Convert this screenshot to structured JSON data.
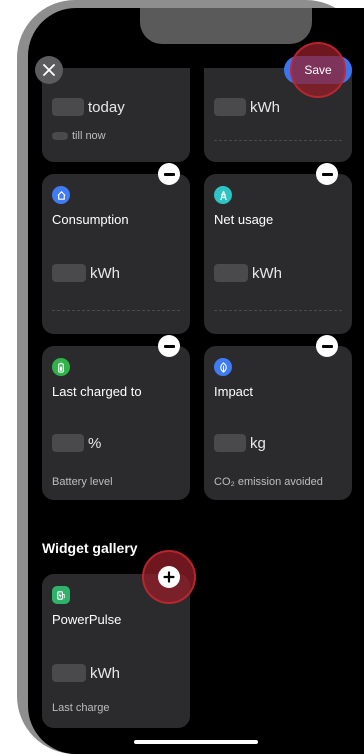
{
  "header": {
    "save_label": "Save"
  },
  "top_cards": [
    {
      "unit": "today",
      "caption": "till now"
    },
    {
      "unit": "kWh"
    }
  ],
  "widgets": [
    {
      "title": "Consumption",
      "unit": "kWh",
      "icon": "home-icon",
      "color": "#3f7bf5"
    },
    {
      "title": "Net usage",
      "unit": "kWh",
      "icon": "tower-icon",
      "color": "#2ec4c4"
    },
    {
      "title": "Last charged to",
      "unit": "%",
      "caption": "Battery level",
      "icon": "battery-icon",
      "color": "#2fb34a"
    },
    {
      "title": "Impact",
      "unit": "kg",
      "caption": "CO₂ emission avoided",
      "icon": "leaf-icon",
      "color": "#3f7bf5"
    }
  ],
  "gallery": {
    "title": "Widget gallery",
    "card": {
      "title": "PowerPulse",
      "unit": "kWh",
      "caption": "Last charge",
      "icon": "charger-icon",
      "color": "#2fb36a"
    }
  },
  "colors": {
    "card_bg": "#2b2b2d",
    "save_bg": "#3b74f0",
    "highlight": "#961e28"
  }
}
